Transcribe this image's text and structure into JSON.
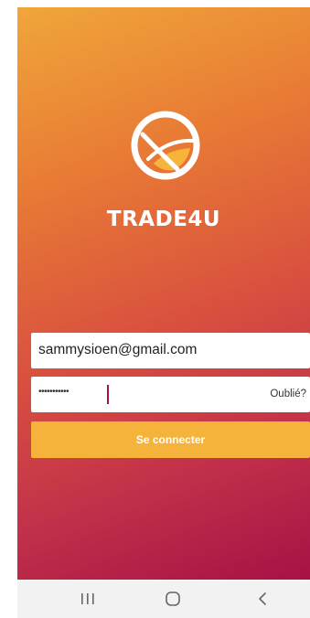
{
  "app": {
    "brand_name": "TRADE4U",
    "logo_icon": "trade4u-logo-icon"
  },
  "login_form": {
    "email_value": "sammysioen@gmail.com",
    "password_masked": "•••••••••••",
    "forgot_label": "Oublié?",
    "submit_label": "Se connecter"
  },
  "navigation_bar": {
    "recent_icon": "recent-apps-icon",
    "home_icon": "home-icon",
    "back_icon": "back-icon"
  },
  "colors": {
    "gradient_top": "#f0a63a",
    "gradient_bottom": "#a71245",
    "button": "#f5b33b",
    "caret": "#a4123f"
  }
}
